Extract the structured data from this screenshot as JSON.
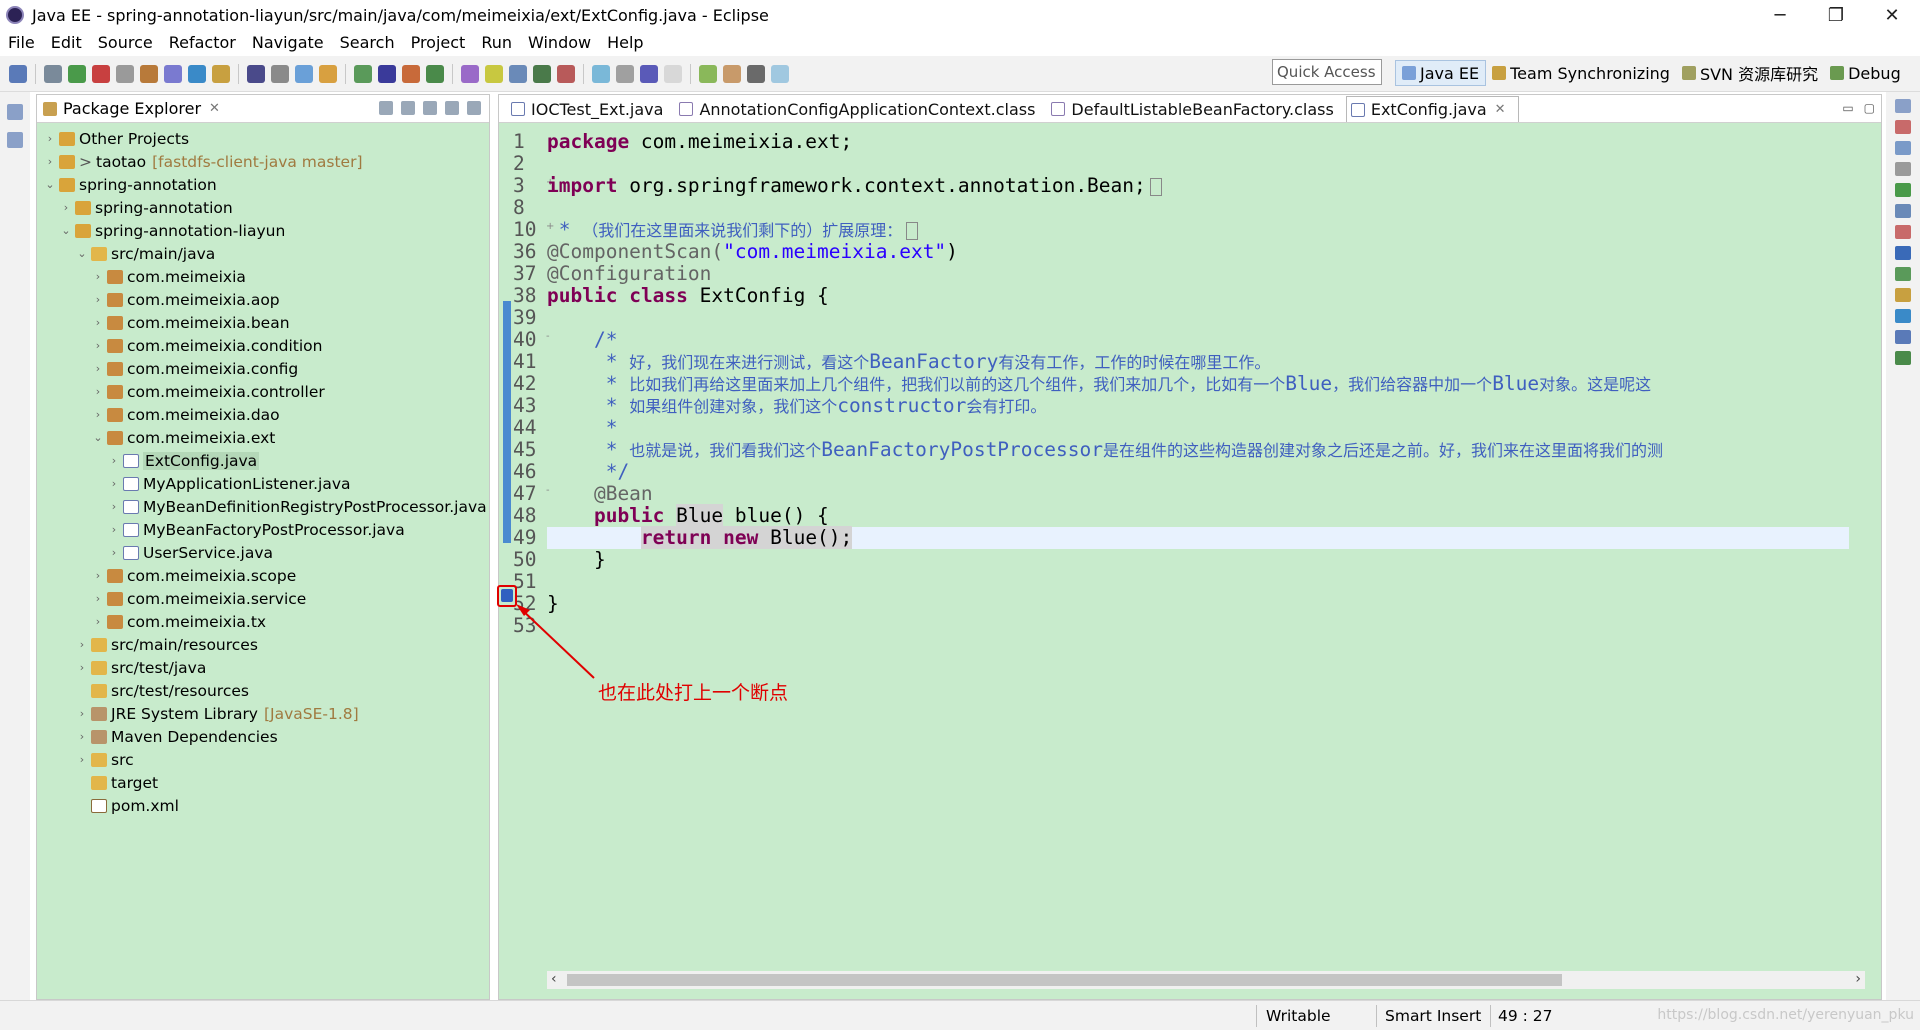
{
  "window": {
    "title": "Java EE - spring-annotation-liayun/src/main/java/com/meimeixia/ext/ExtConfig.java - Eclipse",
    "controls": [
      "─",
      "❐",
      "✕"
    ]
  },
  "menu": [
    "File",
    "Edit",
    "Source",
    "Refactor",
    "Navigate",
    "Search",
    "Project",
    "Run",
    "Window",
    "Help"
  ],
  "toolbar": {
    "quick_access_placeholder": "Quick Access",
    "perspectives": [
      {
        "label": "Java EE",
        "active": true
      },
      {
        "label": "Team Synchronizing",
        "active": false
      },
      {
        "label": "SVN 资源库研究",
        "active": false
      },
      {
        "label": "Debug",
        "active": false
      }
    ]
  },
  "package_explorer": {
    "title": "Package Explorer",
    "close": "✕",
    "tree": [
      {
        "label": "Other Projects",
        "level": 0,
        "arrow": "›",
        "icon": "proj"
      },
      {
        "label": "taotao",
        "prefix": ">",
        "decoration": "[fastdfs-client-java master]",
        "level": 0,
        "arrow": "›",
        "icon": "proj"
      },
      {
        "label": "spring-annotation",
        "level": 0,
        "arrow": "⌄",
        "icon": "proj"
      },
      {
        "label": "spring-annotation",
        "level": 1,
        "arrow": "›",
        "icon": "proj"
      },
      {
        "label": "spring-annotation-liayun",
        "level": 1,
        "arrow": "⌄",
        "icon": "proj"
      },
      {
        "label": "src/main/java",
        "level": 2,
        "arrow": "⌄",
        "icon": "folder"
      },
      {
        "label": "com.meimeixia",
        "level": 3,
        "arrow": "›",
        "icon": "pkgi"
      },
      {
        "label": "com.meimeixia.aop",
        "level": 3,
        "arrow": "›",
        "icon": "pkgi"
      },
      {
        "label": "com.meimeixia.bean",
        "level": 3,
        "arrow": "›",
        "icon": "pkgi"
      },
      {
        "label": "com.meimeixia.condition",
        "level": 3,
        "arrow": "›",
        "icon": "pkgi"
      },
      {
        "label": "com.meimeixia.config",
        "level": 3,
        "arrow": "›",
        "icon": "pkgi"
      },
      {
        "label": "com.meimeixia.controller",
        "level": 3,
        "arrow": "›",
        "icon": "pkgi"
      },
      {
        "label": "com.meimeixia.dao",
        "level": 3,
        "arrow": "›",
        "icon": "pkgi"
      },
      {
        "label": "com.meimeixia.ext",
        "level": 3,
        "arrow": "⌄",
        "icon": "pkgi"
      },
      {
        "label": "ExtConfig.java",
        "level": 4,
        "arrow": "›",
        "icon": "java",
        "selected": true
      },
      {
        "label": "MyApplicationListener.java",
        "level": 4,
        "arrow": "›",
        "icon": "java"
      },
      {
        "label": "MyBeanDefinitionRegistryPostProcessor.java",
        "level": 4,
        "arrow": "›",
        "icon": "java"
      },
      {
        "label": "MyBeanFactoryPostProcessor.java",
        "level": 4,
        "arrow": "›",
        "icon": "java"
      },
      {
        "label": "UserService.java",
        "level": 4,
        "arrow": "›",
        "icon": "java"
      },
      {
        "label": "com.meimeixia.scope",
        "level": 3,
        "arrow": "›",
        "icon": "pkgi"
      },
      {
        "label": "com.meimeixia.service",
        "level": 3,
        "arrow": "›",
        "icon": "pkgi"
      },
      {
        "label": "com.meimeixia.tx",
        "level": 3,
        "arrow": "›",
        "icon": "pkgi"
      },
      {
        "label": "src/main/resources",
        "level": 2,
        "arrow": "›",
        "icon": "folder"
      },
      {
        "label": "src/test/java",
        "level": 2,
        "arrow": "›",
        "icon": "folder"
      },
      {
        "label": "src/test/resources",
        "level": 2,
        "arrow": "",
        "icon": "folder"
      },
      {
        "label": "JRE System Library",
        "decoration": "[JavaSE-1.8]",
        "level": 2,
        "arrow": "›",
        "icon": "lib"
      },
      {
        "label": "Maven Dependencies",
        "level": 2,
        "arrow": "›",
        "icon": "lib"
      },
      {
        "label": "src",
        "level": 2,
        "arrow": "›",
        "icon": "folder"
      },
      {
        "label": "target",
        "level": 2,
        "arrow": "",
        "icon": "folder"
      },
      {
        "label": "pom.xml",
        "level": 2,
        "arrow": "",
        "icon": "xml"
      }
    ]
  },
  "editor": {
    "tabs": [
      {
        "label": "IOCTest_Ext.java",
        "active": false
      },
      {
        "label": "AnnotationConfigApplicationContext.class",
        "active": false
      },
      {
        "label": "DefaultListableBeanFactory.class",
        "active": false
      },
      {
        "label": "ExtConfig.java",
        "active": true,
        "close": "✕"
      }
    ],
    "lines": [
      {
        "no": "1",
        "fold": "",
        "segs": [
          {
            "t": "package",
            "c": "kw"
          },
          {
            "t": " com.meimeixia.ext;",
            "c": ""
          }
        ]
      },
      {
        "no": "2",
        "fold": "",
        "segs": []
      },
      {
        "no": "3",
        "fold": "+",
        "segs": [
          {
            "t": "import",
            "c": "kw"
          },
          {
            "t": " org.springframework.context.annotation.Bean;",
            "c": ""
          }
        ],
        "box": true
      },
      {
        "no": "8",
        "fold": "",
        "segs": []
      },
      {
        "no": "10",
        "fold": "+",
        "segs": [
          {
            "t": " * ",
            "c": "cm"
          },
          {
            "t": "（我们在这里面来说我们剩下的）扩展原理：",
            "c": "cmz"
          }
        ],
        "box": true
      },
      {
        "no": "36",
        "fold": "",
        "segs": [
          {
            "t": "@ComponentScan(",
            "c": "ann"
          },
          {
            "t": "\"com.meimeixia.ext\"",
            "c": "str"
          },
          {
            "t": ")",
            "c": ""
          }
        ]
      },
      {
        "no": "37",
        "fold": "",
        "segs": [
          {
            "t": "@Configuration",
            "c": "ann"
          }
        ]
      },
      {
        "no": "38",
        "fold": "",
        "segs": [
          {
            "t": "public",
            "c": "kw"
          },
          {
            "t": " ",
            "c": ""
          },
          {
            "t": "class",
            "c": "kw"
          },
          {
            "t": " ExtConfig {",
            "c": ""
          }
        ]
      },
      {
        "no": "39",
        "fold": "",
        "segs": []
      },
      {
        "no": "40",
        "fold": "-",
        "segs": [
          {
            "t": "    /*",
            "c": "cm"
          }
        ]
      },
      {
        "no": "41",
        "fold": "",
        "segs": [
          {
            "t": "     * ",
            "c": "cm"
          },
          {
            "t": "好，我们现在来进行测试，看这个",
            "c": "cmz"
          },
          {
            "t": "BeanFactory",
            "c": "cm"
          },
          {
            "t": "有没有工作，工作的时候在哪里工作。",
            "c": "cmz"
          }
        ]
      },
      {
        "no": "42",
        "fold": "",
        "segs": [
          {
            "t": "     * ",
            "c": "cm"
          },
          {
            "t": "比如我们再给这里面来加上几个组件，把我们以前的这几个组件，我们来加几个，比如有一个",
            "c": "cmz"
          },
          {
            "t": "Blue",
            "c": "cm"
          },
          {
            "t": "，我们给容器中加一个",
            "c": "cmz"
          },
          {
            "t": "Blue",
            "c": "cm"
          },
          {
            "t": "对象。这是呢这",
            "c": "cmz"
          }
        ]
      },
      {
        "no": "43",
        "fold": "",
        "segs": [
          {
            "t": "     * ",
            "c": "cm"
          },
          {
            "t": "如果组件创建对象，我们这个",
            "c": "cmz"
          },
          {
            "t": "constructor",
            "c": "cm"
          },
          {
            "t": "会有打印。",
            "c": "cmz"
          }
        ]
      },
      {
        "no": "44",
        "fold": "",
        "segs": [
          {
            "t": "     *",
            "c": "cm"
          }
        ]
      },
      {
        "no": "45",
        "fold": "",
        "segs": [
          {
            "t": "     * ",
            "c": "cm"
          },
          {
            "t": "也就是说，我们看我们这个",
            "c": "cmz"
          },
          {
            "t": "BeanFactoryPostProcessor",
            "c": "cm"
          },
          {
            "t": "是在组件的这些构造器创建对象之后还是之前。好，我们来在这里面将我们的测",
            "c": "cmz"
          }
        ]
      },
      {
        "no": "46",
        "fold": "",
        "segs": [
          {
            "t": "     */",
            "c": "cm"
          }
        ]
      },
      {
        "no": "47",
        "fold": "-",
        "segs": [
          {
            "t": "    @Bean",
            "c": "ann"
          }
        ]
      },
      {
        "no": "48",
        "fold": "",
        "segs": [
          {
            "t": "    ",
            "c": ""
          },
          {
            "t": "public",
            "c": "kw"
          },
          {
            "t": " ",
            "c": ""
          },
          {
            "t": "Blue",
            "c": "hl"
          },
          {
            "t": " blue() {",
            "c": ""
          }
        ]
      },
      {
        "no": "49",
        "fold": "",
        "segs": [
          {
            "t": "        ",
            "c": ""
          },
          {
            "t": "return new Blue();",
            "c": "hlret"
          }
        ],
        "current": true
      },
      {
        "no": "50",
        "fold": "",
        "segs": [
          {
            "t": "    }",
            "c": ""
          }
        ]
      },
      {
        "no": "51",
        "fold": "",
        "segs": []
      },
      {
        "no": "52",
        "fold": "",
        "segs": [
          {
            "t": "}",
            "c": ""
          }
        ]
      },
      {
        "no": "53",
        "fold": "",
        "segs": []
      }
    ]
  },
  "annotation": {
    "text": "也在此处打上一个断点",
    "color": "#e00000"
  },
  "status": {
    "writable": "Writable",
    "insert_mode": "Smart Insert",
    "position": "49 : 27",
    "watermark": "https://blog.csdn.net/yerenyuan_pku"
  },
  "colors": {
    "editor_bg": "#c8ebcc",
    "keyword": "#7f0055",
    "string": "#2a00ff",
    "comment": "#3f5fbf"
  }
}
